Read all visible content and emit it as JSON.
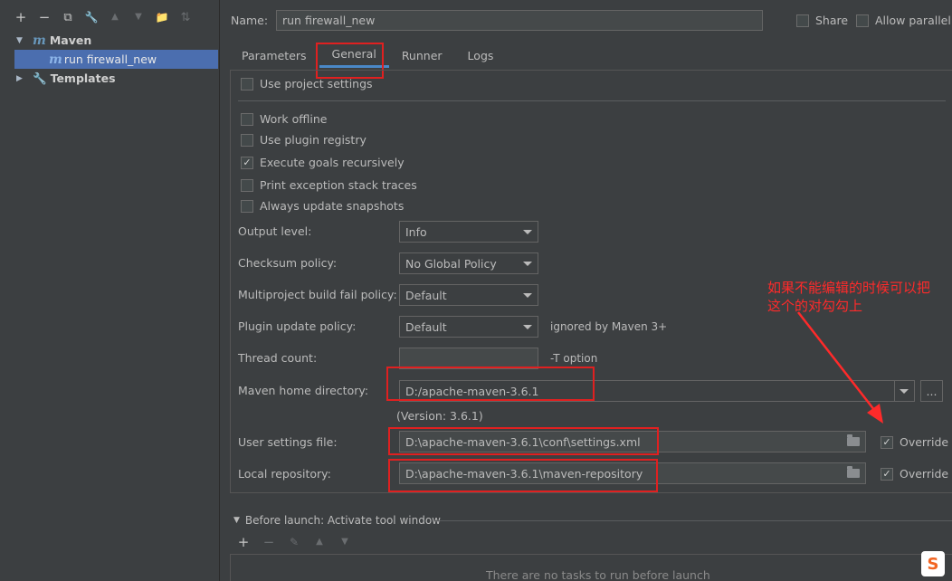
{
  "left": {
    "toolbar": [
      {
        "name": "add-icon",
        "glyph": "+"
      },
      {
        "name": "remove-icon",
        "glyph": "−"
      },
      {
        "name": "copy-icon",
        "glyph": "⧉"
      },
      {
        "name": "wrench-icon",
        "glyph": "🔧"
      },
      {
        "name": "move-up-icon",
        "glyph": "▲"
      },
      {
        "name": "move-down-icon",
        "glyph": "▼"
      },
      {
        "name": "new-folder-icon",
        "glyph": "📁"
      },
      {
        "name": "sort-icon",
        "glyph": "⇅"
      }
    ],
    "tree": {
      "maven_label": "Maven",
      "run_config_label": "run firewall_new",
      "templates_label": "Templates"
    }
  },
  "header": {
    "name_label": "Name:",
    "name_value": "run firewall_new",
    "share_label": "Share",
    "allow_parallel_label": "Allow parallel r"
  },
  "tabs": [
    "Parameters",
    "General",
    "Runner",
    "Logs"
  ],
  "general": {
    "use_project_settings": "Use project settings",
    "work_offline": "Work offline",
    "use_plugin_registry": "Use plugin registry",
    "execute_goals": "Execute goals recursively",
    "print_exception": "Print exception stack traces",
    "always_update": "Always update snapshots",
    "output_level_label": "Output level:",
    "output_level_value": "Info",
    "checksum_label": "Checksum policy:",
    "checksum_value": "No Global Policy",
    "multiproject_label": "Multiproject build fail policy:",
    "multiproject_value": "Default",
    "plugin_update_label": "Plugin update policy:",
    "plugin_update_value": "Default",
    "plugin_update_hint": "ignored by Maven 3+",
    "thread_count_label": "Thread count:",
    "thread_count_value": "",
    "thread_count_hint": "-T option",
    "maven_home_label": "Maven home directory:",
    "maven_home_value": "D:/apache-maven-3.6.1",
    "browse_label": "...",
    "version_text": "(Version: 3.6.1)",
    "user_settings_label": "User settings file:",
    "user_settings_value": "D:\\apache-maven-3.6.1\\conf\\settings.xml",
    "local_repo_label": "Local repository:",
    "local_repo_value": "D:\\apache-maven-3.6.1\\maven-repository",
    "override_label": "Override"
  },
  "before_launch": {
    "title": "Before launch: Activate tool window",
    "empty_text": "There are no tasks to run before launch"
  },
  "annotation": {
    "line1": "如果不能编辑的时候可以把",
    "line2": "这个的对勾勾上"
  },
  "ime_badge": "S",
  "colors": {
    "accent": "#4b6eaf",
    "annotation": "#ff2a2a"
  }
}
